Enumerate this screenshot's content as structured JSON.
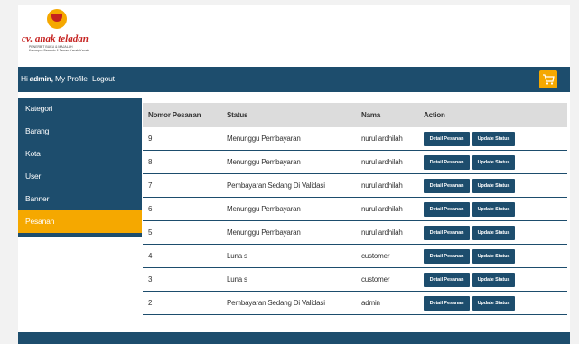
{
  "logo": {
    "title": "cv. anak teladan",
    "subtitle_line1": "PENERBIT BUKU & MAJALAH",
    "subtitle_line2": "Kelompok Bermain & Taman Kanak-Kanak"
  },
  "navbar": {
    "greeting": "Hi",
    "username": "admin,",
    "profile_link": "My Profile",
    "logout_link": "Logout",
    "cart_icon": "cart-icon"
  },
  "sidebar": {
    "items": [
      {
        "label": "Kategori"
      },
      {
        "label": "Barang"
      },
      {
        "label": "Kota"
      },
      {
        "label": "User"
      },
      {
        "label": "Banner"
      },
      {
        "label": "Pesanan"
      }
    ],
    "active": "Pesanan"
  },
  "table": {
    "headers": [
      "Nomor Pesanan",
      "Status",
      "Nama",
      "Action"
    ],
    "rows": [
      {
        "no": "9",
        "status": "Menunggu Pembayaran",
        "nama": "nurul ardhilah"
      },
      {
        "no": "8",
        "status": "Menunggu Pembayaran",
        "nama": "nurul ardhilah"
      },
      {
        "no": "7",
        "status": "Pembayaran Sedang Di Validasi",
        "nama": "nurul ardhilah"
      },
      {
        "no": "6",
        "status": "Menunggu Pembayaran",
        "nama": "nurul ardhilah"
      },
      {
        "no": "5",
        "status": "Menunggu Pembayaran",
        "nama": "nurul ardhilah"
      },
      {
        "no": "4",
        "status": "Luna s",
        "nama": "customer"
      },
      {
        "no": "3",
        "status": "Luna s",
        "nama": "customer"
      },
      {
        "no": "2",
        "status": "Pembayaran Sedang Di Validasi",
        "nama": "admin"
      }
    ],
    "detail_label": "Detail Pesanan",
    "update_label": "Update Status"
  },
  "colors": {
    "primary": "#1d4d6d",
    "accent": "#f5a800",
    "header_bg": "#dcdcdc"
  }
}
